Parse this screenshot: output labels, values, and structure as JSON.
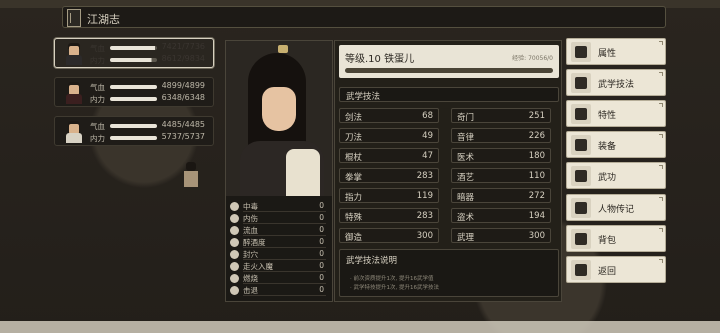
{
  "header": {
    "title": "江湖志"
  },
  "party": [
    {
      "hp_label": "气血",
      "hp": "7421/7736",
      "hp_pct": 0.96,
      "mp_label": "内力",
      "mp": "8612/9834",
      "mp_pct": 0.88
    },
    {
      "hp_label": "气血",
      "hp": "4899/4899",
      "hp_pct": 1.0,
      "mp_label": "内力",
      "mp": "6348/6348",
      "mp_pct": 1.0
    },
    {
      "hp_label": "气血",
      "hp": "4485/4485",
      "hp_pct": 1.0,
      "mp_label": "内力",
      "mp": "5737/5737",
      "mp_pct": 1.0
    }
  ],
  "character": {
    "level_title": "等级.10  铁蛋儿",
    "exp": "经验: 70056/0",
    "exp_pct": 1.0
  },
  "status": [
    {
      "label": "中毒",
      "value": "0"
    },
    {
      "label": "内伤",
      "value": "0"
    },
    {
      "label": "流血",
      "value": "0"
    },
    {
      "label": "醉酒度",
      "value": "0"
    },
    {
      "label": "封穴",
      "value": "0"
    },
    {
      "label": "走火入魔",
      "value": "0"
    },
    {
      "label": "燃烧",
      "value": "0"
    },
    {
      "label": "击退",
      "value": "0"
    }
  ],
  "skills_section": "武学技法",
  "skills": [
    {
      "name": "剑法",
      "value": "68"
    },
    {
      "name": "奇门",
      "value": "251"
    },
    {
      "name": "刀法",
      "value": "49"
    },
    {
      "name": "音律",
      "value": "226"
    },
    {
      "name": "棍杖",
      "value": "47"
    },
    {
      "name": "医术",
      "value": "180"
    },
    {
      "name": "拳掌",
      "value": "283"
    },
    {
      "name": "酒艺",
      "value": "110"
    },
    {
      "name": "指力",
      "value": "119"
    },
    {
      "name": "暗器",
      "value": "272"
    },
    {
      "name": "特殊",
      "value": "283"
    },
    {
      "name": "盗术",
      "value": "194"
    },
    {
      "name": "御造",
      "value": "300"
    },
    {
      "name": "武理",
      "value": "300"
    }
  ],
  "description": {
    "title": "武学技法说明",
    "lines": [
      "· 前次资质提升1次, 提升16武学值",
      "· 武学特技提升1次, 提升16武学技法"
    ]
  },
  "menu": [
    {
      "label": "属性",
      "icon": "attribute-icon"
    },
    {
      "label": "武学技法",
      "icon": "martial-skill-icon"
    },
    {
      "label": "特性",
      "icon": "trait-icon"
    },
    {
      "label": "装备",
      "icon": "sword-icon"
    },
    {
      "label": "武功",
      "icon": "scroll-icon"
    },
    {
      "label": "人物传记",
      "icon": "biography-icon"
    },
    {
      "label": "背包",
      "icon": "bag-icon"
    },
    {
      "label": "返回",
      "icon": "return-icon"
    }
  ]
}
